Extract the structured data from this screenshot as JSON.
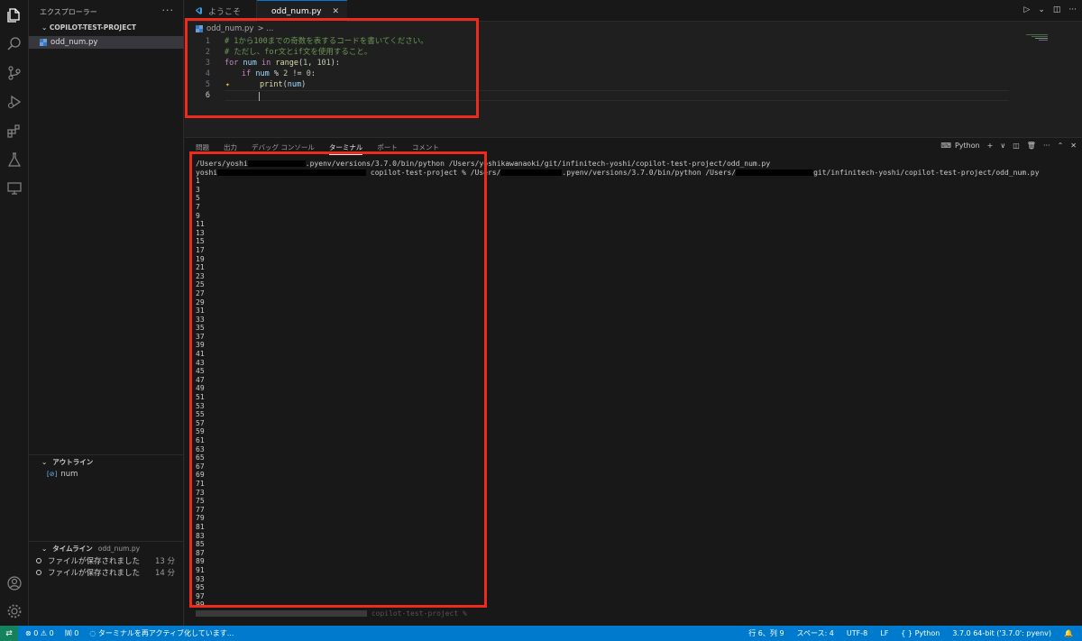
{
  "sidebar": {
    "title": "エクスプローラー",
    "more": "···",
    "project": "COPILOT-TEST-PROJECT",
    "file": "odd_num.py",
    "outline": {
      "title": "アウトライン",
      "item_icon": "[⊘]",
      "item": "num"
    },
    "timeline": {
      "title": "タイムライン",
      "file": "odd_num.py",
      "entries": [
        {
          "label": "ファイルが保存されました",
          "when": "13 分"
        },
        {
          "label": "ファイルが保存されました",
          "when": "14 分"
        }
      ]
    }
  },
  "tabs": {
    "welcome": "ようこそ",
    "active": "odd_num.py",
    "close": "✕"
  },
  "editor": {
    "breadcrumb_file": "odd_num.py",
    "breadcrumb_sep": "> ...",
    "line_numbers": [
      "1",
      "2",
      "3",
      "4",
      "5",
      "6"
    ],
    "lines": {
      "l1": "# 1から100までの奇数を表するコードを書いてください。",
      "l2": "# ただし、for文とif文を使用すること。",
      "l3_kw1": "for",
      "l3_var": "num",
      "l3_kw2": "in",
      "l3_fn": "range",
      "l3_open": "(",
      "l3_n1": "1",
      "l3_comma": ", ",
      "l3_n2": "101",
      "l3_close": "):",
      "l4_kw": "if",
      "l4_var": "num",
      "l4_op1": " % ",
      "l4_n1": "2",
      "l4_op2": " != ",
      "l4_n2": "0",
      "l4_colon": ":",
      "l5_fn": "print",
      "l5_open": "(",
      "l5_var": "num",
      "l5_close": ")"
    }
  },
  "panel": {
    "tabs": [
      "問題",
      "出力",
      "デバッグ コンソール",
      "ターミナル",
      "ポート",
      "コメント"
    ],
    "terminal_label": "Python",
    "add": "+",
    "chev": "∨",
    "more": "···",
    "cmd1_a": "/Users/yoshi",
    "cmd1_b": ".pyenv/versions/3.7.0/bin/python /Users/yoshikawanaoki/git/infinitech-yoshi/copilot-test-project/odd_num.py",
    "cmd2_a": "yoshi",
    "cmd2_b": "copilot-test-project % /Users/",
    "cmd2_c": ".pyenv/versions/3.7.0/bin/python /Users/",
    "cmd2_d": "git/infinitech-yoshi/copilot-test-project/odd_num.py",
    "output": [
      "1",
      "3",
      "5",
      "7",
      "9",
      "11",
      "13",
      "15",
      "17",
      "19",
      "21",
      "23",
      "25",
      "27",
      "29",
      "31",
      "33",
      "35",
      "37",
      "39",
      "41",
      "43",
      "45",
      "47",
      "49",
      "51",
      "53",
      "55",
      "57",
      "59",
      "61",
      "63",
      "65",
      "67",
      "69",
      "71",
      "73",
      "75",
      "77",
      "79",
      "81",
      "83",
      "85",
      "87",
      "89",
      "91",
      "93",
      "95",
      "97",
      "99"
    ],
    "prompt_tail": "copilot-test-project %"
  },
  "status": {
    "remote": "⇄",
    "errors": "⊗ 0 ⚠ 0",
    "ports": "🄦 0",
    "reactivate": "◌ ターミナルを再アクティブ化しています...",
    "position": "行 6、列 9",
    "spaces": "スペース: 4",
    "encoding": "UTF-8",
    "eol": "LF",
    "language": "Python",
    "interpreter": "3.7.0 64-bit ('3.7.0': pyenv)"
  },
  "colors": {
    "accent": "#007acc",
    "highlight": "#ee2a1b",
    "editor_bg": "#1f1f1f",
    "panel_bg": "#181818"
  }
}
